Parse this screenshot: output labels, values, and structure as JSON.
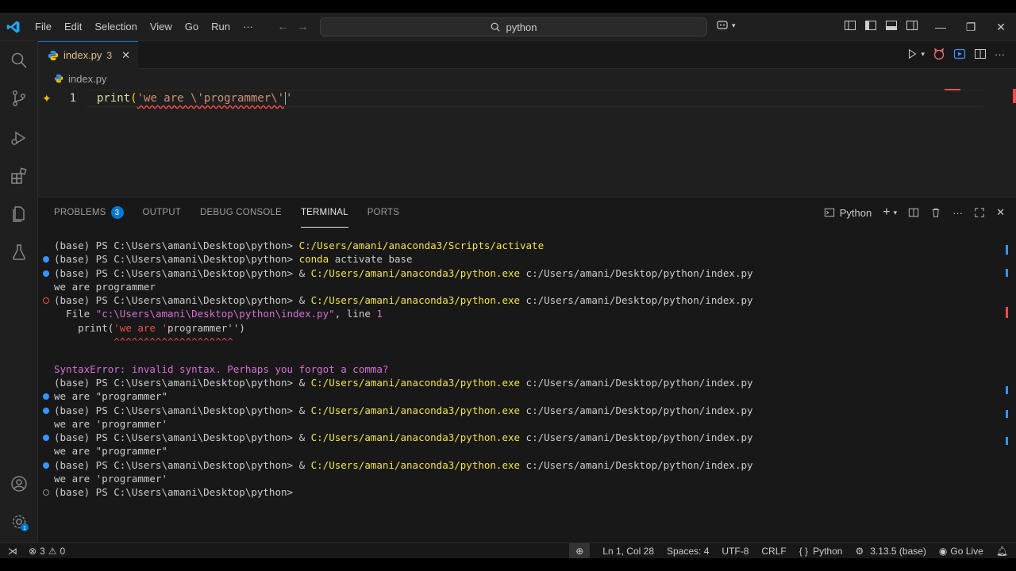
{
  "menu": [
    "File",
    "Edit",
    "Selection",
    "View",
    "Go",
    "Run",
    "···"
  ],
  "search": {
    "label": "python"
  },
  "tab": {
    "name": "index.py",
    "problems": "3"
  },
  "breadcrumb": "index.py",
  "editor": {
    "line_number": "1",
    "code_fn": "print",
    "code_open": "(",
    "code_str": "'we are \\'programmer\\'",
    "code_tail": "'"
  },
  "panel": {
    "tabs": [
      "PROBLEMS",
      "OUTPUT",
      "DEBUG CONSOLE",
      "TERMINAL",
      "PORTS"
    ],
    "problems_badge": "3",
    "active_tab": "TERMINAL",
    "shell": "Python"
  },
  "terminal": {
    "lines": [
      {
        "dot": "none",
        "prompt": "(base) PS C:\\Users\\amani\\Desktop\\python> ",
        "cmd": "C:/Users/amani/anaconda3/Scripts/activate",
        "rest": ""
      },
      {
        "dot": "blue",
        "prompt": "(base) PS C:\\Users\\amani\\Desktop\\python> ",
        "cmd": "conda",
        "rest": " activate base"
      },
      {
        "dot": "blue",
        "prompt": "(base) PS C:\\Users\\amani\\Desktop\\python> ",
        "pre": "& ",
        "cmd": "C:/Users/amani/anaconda3/python.exe",
        "rest": " c:/Users/amani/Desktop/python/index.py"
      },
      {
        "dot": "none",
        "text": "we are programmer"
      },
      {
        "dot": "err",
        "prompt": "(base) PS C:\\Users\\amani\\Desktop\\python> ",
        "pre": "& ",
        "cmd": "C:/Users/amani/anaconda3/python.exe",
        "rest": " c:/Users/amani/Desktop/python/index.py"
      },
      {
        "dot": "none",
        "file_line": true,
        "a": "  File ",
        "b": "\"c:\\Users\\amani\\Desktop\\python\\index.py\"",
        "c": ", line ",
        "d": "1"
      },
      {
        "dot": "none",
        "code_line": true,
        "a": "    print(",
        "b": "'we are '",
        "c": "programmer",
        "d": "'')"
      },
      {
        "dot": "none",
        "caret": "          ^^^^^^^^^^^^^^^^^^^^"
      },
      {
        "dot": "none",
        "text": ""
      },
      {
        "dot": "none",
        "syntax": true,
        "a": "SyntaxError",
        "b": ": invalid syntax. Perhaps you forgot a comma?"
      },
      {
        "dot": "none",
        "prompt": "(base) PS C:\\Users\\amani\\Desktop\\python> ",
        "pre": "& ",
        "cmd": "C:/Users/amani/anaconda3/python.exe",
        "rest": " c:/Users/amani/Desktop/python/index.py"
      },
      {
        "dot": "blue",
        "text": "we are \"programmer\""
      },
      {
        "dot": "blue",
        "prompt": "(base) PS C:\\Users\\amani\\Desktop\\python> ",
        "pre": "& ",
        "cmd": "C:/Users/amani/anaconda3/python.exe",
        "rest": " c:/Users/amani/Desktop/python/index.py"
      },
      {
        "dot": "none",
        "text": "we are 'programmer'"
      },
      {
        "dot": "blue",
        "prompt": "(base) PS C:\\Users\\amani\\Desktop\\python> ",
        "pre": "& ",
        "cmd": "C:/Users/amani/anaconda3/python.exe",
        "rest": " c:/Users/amani/Desktop/python/index.py"
      },
      {
        "dot": "none",
        "text": "we are \"programmer\""
      },
      {
        "dot": "blue",
        "prompt": "(base) PS C:\\Users\\amani\\Desktop\\python> ",
        "pre": "& ",
        "cmd": "C:/Users/amani/anaconda3/python.exe",
        "rest": " c:/Users/amani/Desktop/python/index.py"
      },
      {
        "dot": "none",
        "text": "we are 'programmer'"
      },
      {
        "dot": "empty",
        "prompt": "(base) PS C:\\Users\\amani\\Desktop\\python> ",
        "cmd": "",
        "rest": ""
      }
    ]
  },
  "status": {
    "errors": "3",
    "warnings": "0",
    "position": "Ln 1, Col 28",
    "spaces": "Spaces: 4",
    "encoding": "UTF-8",
    "eol": "CRLF",
    "language": "Python",
    "interpreter": "3.13.5 (base)",
    "live": "Go Live"
  },
  "colors": {
    "accent": "#0078d4",
    "error": "#f14c4c",
    "command": "#f2e34c",
    "modified_tab": "#e2c08d"
  }
}
